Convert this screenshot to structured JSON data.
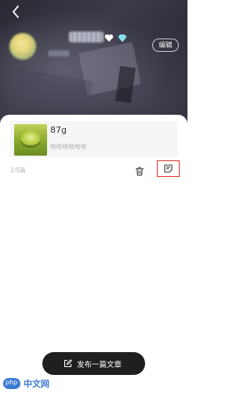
{
  "header": {
    "edit_label": "编辑"
  },
  "article": {
    "title": "87g",
    "subtitle": "哈哈哈哈哈哈"
  },
  "list": {
    "count_label": "1/5篇"
  },
  "publish": {
    "label": "发布一篇文章"
  },
  "watermark": {
    "badge": "php",
    "text": "中文网"
  },
  "colors": {
    "header_bg": "#2a2a35",
    "highlight_border": "#e0312a",
    "publish_bg": "#1f1f1f",
    "card_bg": "#f5f5f5",
    "muted_text": "#a8a8a8",
    "diamond": "#8fe3f0"
  },
  "icons": {
    "back": "chevron-left-icon",
    "heart_badge": "heart-icon",
    "diamond_badge": "diamond-icon",
    "delete": "trash-icon",
    "note": "note-icon",
    "pen": "edit-pen-icon"
  }
}
